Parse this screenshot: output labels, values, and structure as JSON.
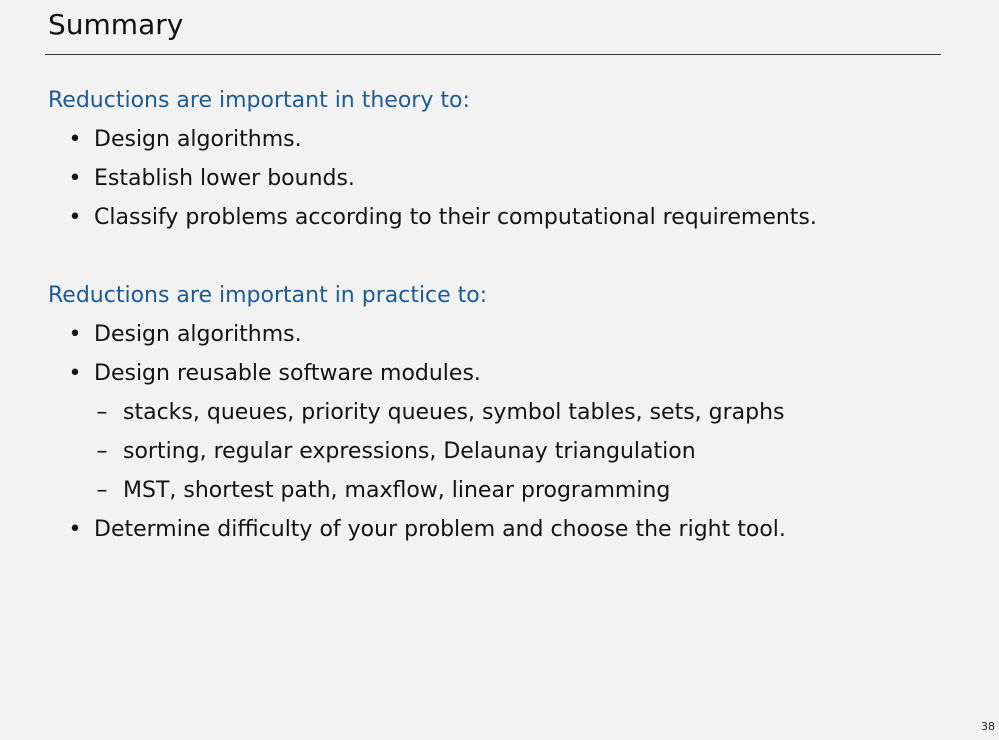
{
  "slide": {
    "title": "Summary",
    "page_number": "38"
  },
  "theory": {
    "heading": "Reductions are important in theory to:",
    "bullets": [
      "Design algorithms.",
      "Establish lower bounds.",
      "Classify problems according to their computational requirements."
    ]
  },
  "practice": {
    "heading": "Reductions are important in practice to:",
    "bullets": [
      "Design algorithms.",
      "Design reusable software modules.",
      "Determine difficulty of your problem and choose the right tool."
    ],
    "sub_bullets": [
      "stacks, queues, priority queues, symbol tables, sets, graphs",
      "sorting, regular expressions, Delaunay triangulation",
      "MST, shortest path, maxflow, linear programming"
    ]
  },
  "markers": {
    "bullet": "•",
    "dash": "–"
  }
}
